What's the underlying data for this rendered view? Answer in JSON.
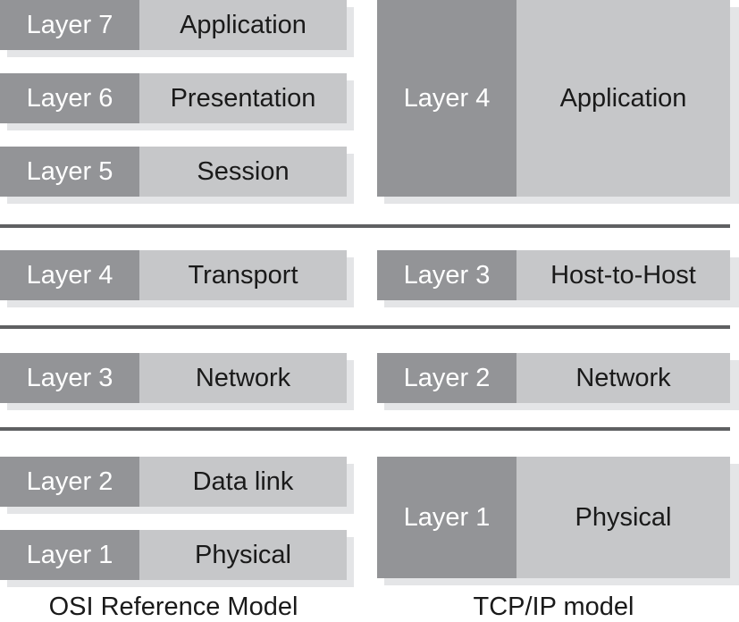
{
  "osi": {
    "caption": "OSI Reference Model",
    "layers": [
      {
        "num": "Layer 7",
        "name": "Application"
      },
      {
        "num": "Layer 6",
        "name": "Presentation"
      },
      {
        "num": "Layer 5",
        "name": "Session"
      },
      {
        "num": "Layer 4",
        "name": "Transport"
      },
      {
        "num": "Layer 3",
        "name": "Network"
      },
      {
        "num": "Layer 2",
        "name": "Data link"
      },
      {
        "num": "Layer 1",
        "name": "Physical"
      }
    ]
  },
  "tcpip": {
    "caption": "TCP/IP model",
    "layers": [
      {
        "num": "Layer 4",
        "name": "Application"
      },
      {
        "num": "Layer 3",
        "name": "Host-to-Host"
      },
      {
        "num": "Layer 2",
        "name": "Network"
      },
      {
        "num": "Layer 1",
        "name": "Physical"
      }
    ]
  },
  "colors": {
    "dark": "#939497",
    "light": "#c6c7c9",
    "shadow": "#e4e5e7",
    "separator": "#5f6062"
  }
}
